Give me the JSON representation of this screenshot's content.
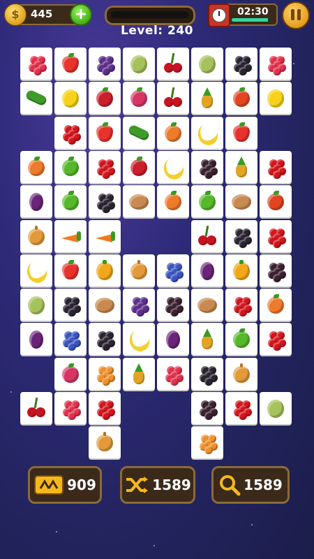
{
  "header": {
    "coins": "445",
    "coin_symbol": "$",
    "add_symbol": "+",
    "level_text": "Level: 240",
    "timer_text": "02:30",
    "timer_fraction": 0.92
  },
  "powerups": [
    {
      "id": "undo",
      "count": "909"
    },
    {
      "id": "shuffle",
      "count": "1589"
    },
    {
      "id": "hint",
      "count": "1589"
    }
  ],
  "fruit_colors": {
    "raspberry": "#e2314d",
    "strawberry": "#e8322c",
    "blackberry": "#2a2431",
    "grape": "#5d2f8c",
    "gooseberry": "#a6c25d",
    "cherry": "#c71422",
    "cucumber": "#3f9a2a",
    "lemon": "#f6d21a",
    "pomegranate": "#cc1f2c",
    "radish": "#d63564",
    "pear": "#f3c53a",
    "tomato": "#e24522",
    "redcurrant": "#d4151c",
    "peach": "#ee7a2c",
    "banana": "#f3cf2e",
    "currant": "#3b2030",
    "pineapple": "#e2a424",
    "apple": "#56b82a",
    "plum": "#6a2478",
    "potato": "#c98a52",
    "onion": "#e39a3a",
    "carrot": "#f07a1e",
    "pepper": "#f2a81a",
    "blueberry": "#3b55c0",
    "cloudberry": "#f0902a"
  },
  "board": [
    [
      "raspberry",
      "strawberry",
      "grape",
      "gooseberry",
      "cherry",
      "gooseberry",
      "blackberry",
      "raspberry"
    ],
    [
      "cucumber",
      "lemon",
      "pomegranate",
      "radish",
      "cherry",
      "pineapple",
      "tomato",
      "lemon"
    ],
    [
      null,
      "redcurrant",
      "strawberry",
      "cucumber",
      "peach",
      "banana",
      "strawberry",
      null
    ],
    [
      "peach",
      "apple",
      "redcurrant",
      "pomegranate",
      "banana",
      "currant",
      "pineapple",
      "redcurrant"
    ],
    [
      "plum",
      "apple",
      "blackberry",
      "potato",
      "peach",
      "apple",
      "potato",
      "tomato"
    ],
    [
      "onion",
      "carrot",
      "carrot",
      null,
      null,
      "cherry",
      "blackberry",
      "redcurrant"
    ],
    [
      "banana",
      "strawberry",
      "pepper",
      "onion",
      "blueberry",
      "plum",
      "pepper",
      "currant"
    ],
    [
      "gooseberry",
      "blackberry",
      "potato",
      "grape",
      "currant",
      "potato",
      "redcurrant",
      "peach"
    ],
    [
      "plum",
      "blueberry",
      "blackberry",
      "banana",
      "plum",
      "pineapple",
      "apple",
      "redcurrant"
    ],
    [
      null,
      "radish",
      "cloudberry",
      "pineapple",
      "raspberry",
      "blackberry",
      "onion",
      null
    ],
    [
      "cherry",
      "raspberry",
      "redcurrant",
      null,
      null,
      "currant",
      "redcurrant",
      "gooseberry"
    ],
    [
      null,
      null,
      "onion",
      null,
      null,
      "cloudberry",
      null,
      null
    ]
  ]
}
